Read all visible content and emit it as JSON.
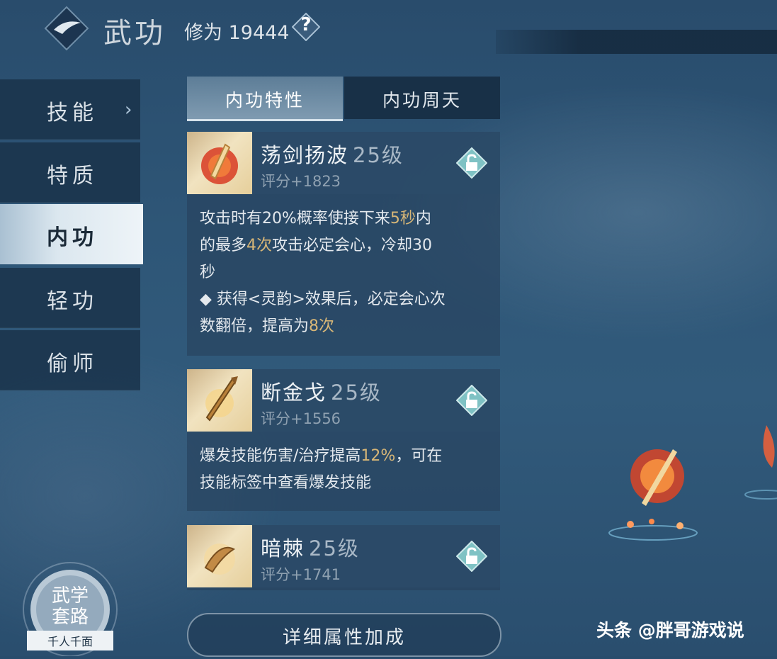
{
  "header": {
    "title": "武功",
    "cultivation": "修为 19444",
    "help_symbol": "?"
  },
  "nav": [
    {
      "label": "技能",
      "chevron": "›"
    },
    {
      "label": "特质"
    },
    {
      "label": "内功"
    },
    {
      "label": "轻功"
    },
    {
      "label": "偷师"
    }
  ],
  "tabs": [
    {
      "label": "内功特性"
    },
    {
      "label": "内功周天"
    }
  ],
  "skills": [
    {
      "name": "荡剑扬波",
      "level": "25级",
      "score": "评分+1823",
      "desc_lines": [
        [
          "攻击时有20%概率使接下来",
          {
            "hl": "5秒"
          },
          "内"
        ],
        [
          "的最多",
          {
            "hl": "4次"
          },
          "攻击必定会心，冷却30"
        ],
        [
          "秒"
        ],
        [
          "◆ 获得<灵韵>效果后，必定会心次"
        ],
        [
          "数翻倍，提高为",
          {
            "hl": "8次"
          }
        ]
      ]
    },
    {
      "name": "断金戈",
      "level": "25级",
      "score": "评分+1556",
      "desc_lines": [
        [
          "爆发技能伤害/治疗提高",
          {
            "hl": "12%"
          },
          "，可在"
        ],
        [
          "技能标签中查看爆发技能"
        ]
      ]
    },
    {
      "name": "暗棘",
      "level": "25级",
      "score": "评分+1741",
      "desc_lines": []
    }
  ],
  "detail_button": "详细属性加成",
  "route": {
    "line1": "武学",
    "line2": "套路",
    "ribbon": "千人千面"
  },
  "watermark": "头条 @胖哥游戏说",
  "colors": {
    "highlight": "#d7b677",
    "active_nav": "#e6eef4",
    "bg": "#2e5677"
  }
}
